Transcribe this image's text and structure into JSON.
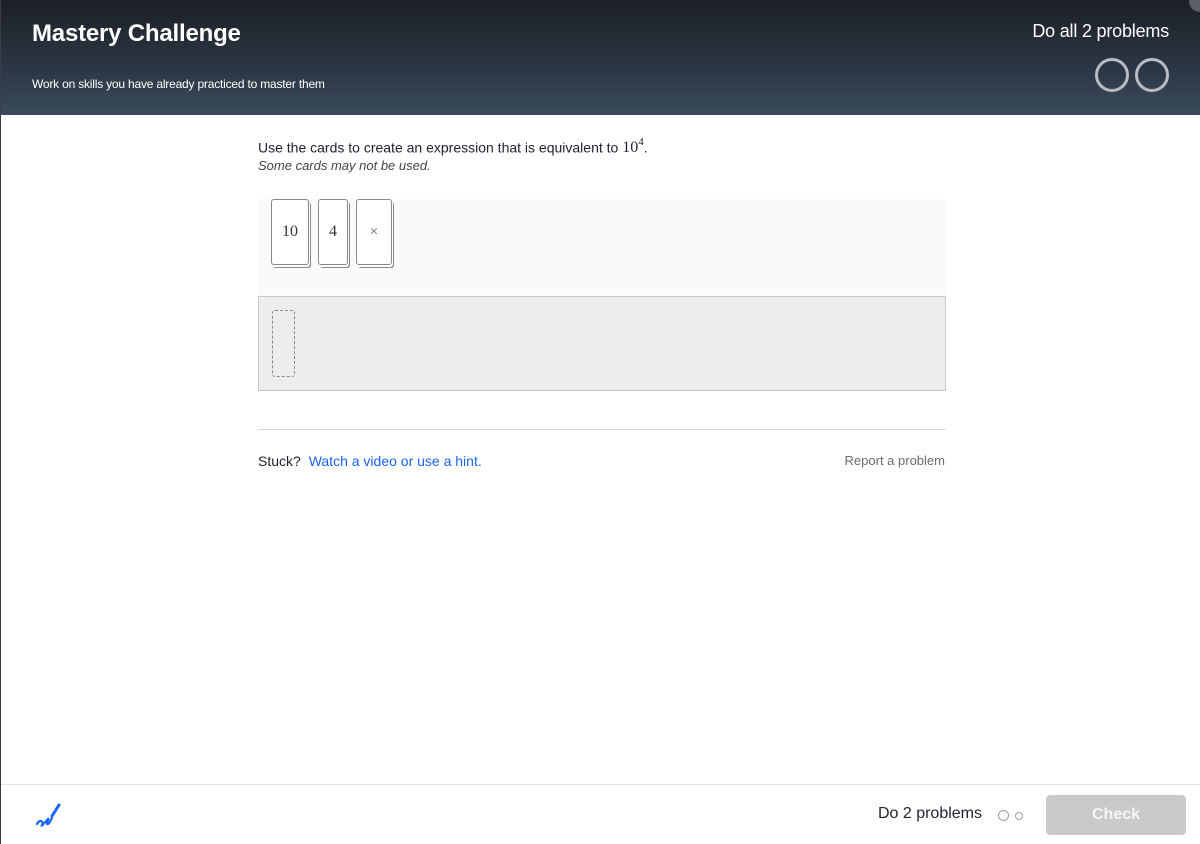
{
  "header": {
    "title": "Mastery Challenge",
    "subtitle": "Work on skills you have already practiced to master them",
    "goal": "Do all 2 problems",
    "progress_total": 2,
    "progress_done": 0
  },
  "problem": {
    "prompt_prefix": "Use the cards to create an expression that is equivalent to ",
    "expression_base": "10",
    "expression_exponent": "4",
    "prompt_suffix": ".",
    "note": "Some cards may not be used.",
    "cards": [
      "10",
      "4",
      "×"
    ]
  },
  "help": {
    "stuck_label": "Stuck?",
    "hint_link": "Watch a video or use a hint.",
    "report_link": "Report a problem"
  },
  "footer": {
    "count_label": "Do 2 problems",
    "check_label": "Check",
    "scratchpad_icon": "pencil-scribble-icon"
  },
  "colors": {
    "link": "#1865f2",
    "header_dark": "#1c2026",
    "check_disabled": "#c9cacc"
  }
}
